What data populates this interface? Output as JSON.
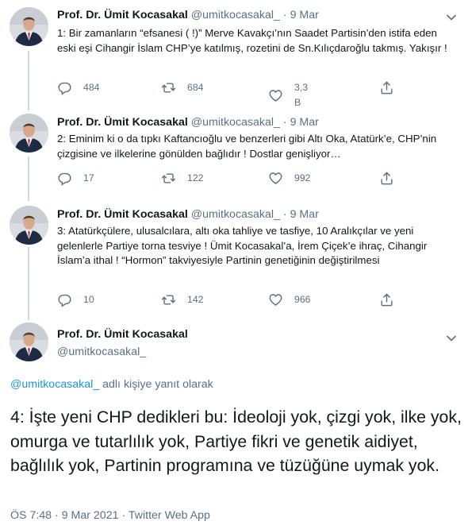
{
  "author": {
    "name": "Prof. Dr. Ümit Kocasakal",
    "handle": "@umitkocasakal_"
  },
  "thread": [
    {
      "date": "9 Mar",
      "text": "1: Bir zamanların “efsanesi ( !)” Merve Kavakçı’nın Saadet Partisin’den istifa eden eski eşi Cihangir İslam CHP’ye katılmış, rozetini de Sn.Kılıçdaroğlu takmış. Yakışır !",
      "replies": "484",
      "retweets": "684",
      "likes": "3,3 B"
    },
    {
      "date": "9 Mar",
      "text": "2: Eminim ki o da tıpkı Kaftancıoğlu ve benzerleri gibi Altı Oka, Atatürk’e, CHP’nin çizgisine ve ilkelerine gönülden bağlıdır ! Dostlar genişliyor…",
      "replies": "17",
      "retweets": "122",
      "likes": "992"
    },
    {
      "date": "9 Mar",
      "text": "3: Atatürkçülere, ulusalcılara, altı oka tahliye ve tasfiye, 10 Aralıkçılar ve yeni gelenlerle Partiye torna tesviye ! Ümit Kocasakal’a, İrem Çiçek’e ihraç, Cihangir İslam’a ithal ! “Hormon” takviyesiyle Partinin genetiğinin değiştirilmesi",
      "replies": "10",
      "retweets": "142",
      "likes": "966"
    }
  ],
  "main_tweet": {
    "reply_mention": "@umitkocasakal_",
    "reply_suffix": " adlı kişiye yanıt olarak",
    "text": "4: İşte yeni CHP dedikleri bu: İdeoloji yok, çizgi yok, ilke yok, omurga ve tutarlılık yok, Partiye fikri ve genetik aidiyet, bağlılık yok, Partinin programına ve tüzüğüne uymak yok.",
    "time": "ÖS 7:48",
    "date": "9 Mar 2021",
    "source": "Twitter Web App"
  },
  "separator": "·",
  "colors": {
    "text": "#14171a",
    "secondary": "#5b7083",
    "link": "#1b95e0",
    "thread_line": "#cfd9de"
  },
  "icons": [
    "reply-icon",
    "retweet-icon",
    "like-icon",
    "share-icon",
    "more-icon"
  ]
}
